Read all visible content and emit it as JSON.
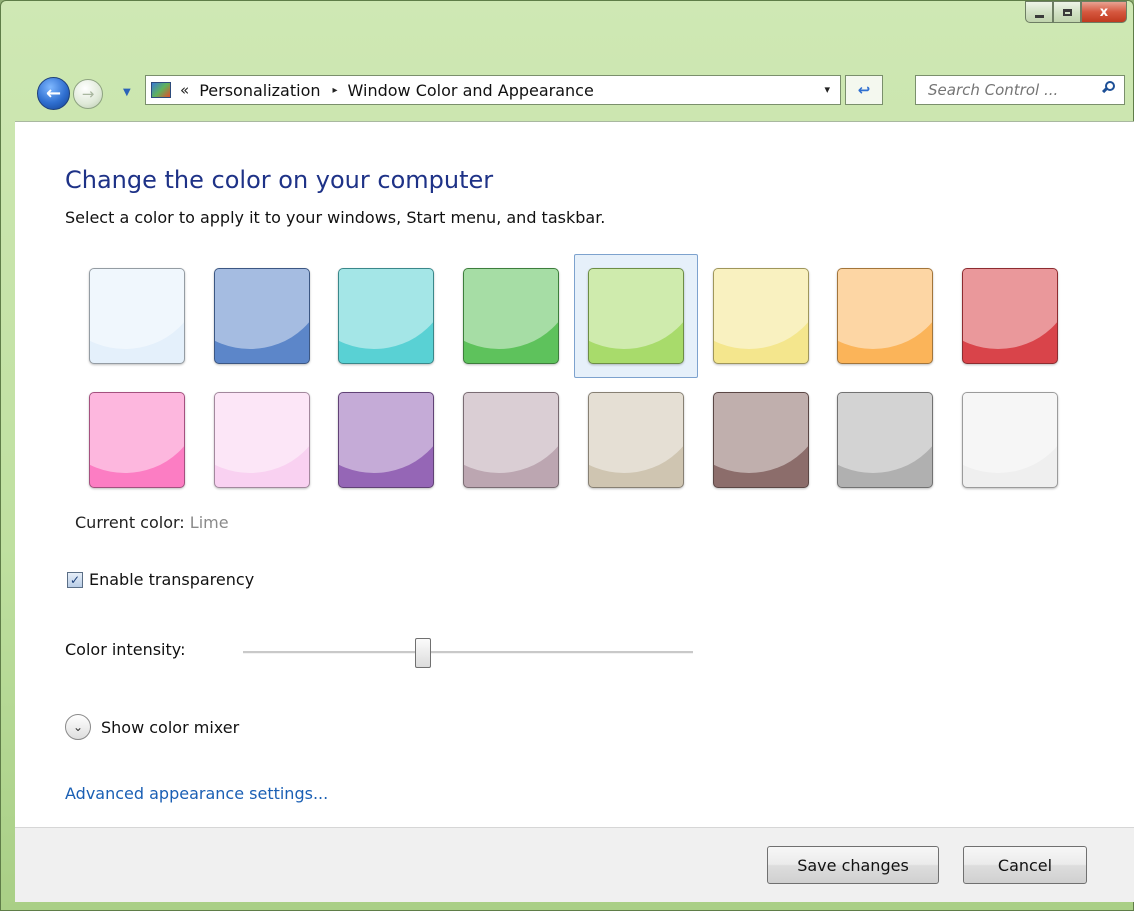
{
  "window": {
    "caption_buttons": {
      "minimize_icon": "minimize-icon",
      "maximize_icon": "maximize-icon",
      "close_label": "x"
    }
  },
  "nav": {
    "back_icon": "back-arrow-icon",
    "forward_icon": "forward-arrow-icon",
    "address": {
      "icon": "control-panel-icon",
      "chevron": "«",
      "segments": [
        "Personalization",
        "Window Color and Appearance"
      ],
      "separator": "▸",
      "dropdown": "▾"
    },
    "refresh_symbol": "↩",
    "search": {
      "placeholder": "Search Control ...",
      "value": ""
    }
  },
  "content": {
    "heading": "Change the color on your computer",
    "subtext": "Select a color to apply it to your windows, Start menu, and taskbar.",
    "swatches": [
      {
        "color": "#e4f0fb",
        "selected": false
      },
      {
        "color": "#5c86c9",
        "selected": false
      },
      {
        "color": "#59d1d4",
        "selected": false
      },
      {
        "color": "#5ec25c",
        "selected": false
      },
      {
        "color": "#a8db6b",
        "selected": true
      },
      {
        "color": "#f4e68d",
        "selected": false
      },
      {
        "color": "#fbb459",
        "selected": false
      },
      {
        "color": "#d9444a",
        "selected": false
      },
      {
        "color": "#fc7dc3",
        "selected": false
      },
      {
        "color": "#f9d1f1",
        "selected": false
      },
      {
        "color": "#9566b6",
        "selected": false
      },
      {
        "color": "#bca6b1",
        "selected": false
      },
      {
        "color": "#cfc5b1",
        "selected": false
      },
      {
        "color": "#8c6d6b",
        "selected": false
      },
      {
        "color": "#b0b0b0",
        "selected": false
      },
      {
        "color": "#efefef",
        "selected": false
      }
    ],
    "current_color_label": "Current color:",
    "current_color_value": "Lime",
    "transparency_label": "Enable transparency",
    "transparency_checked": true,
    "intensity_label": "Color intensity:",
    "intensity_fraction": 0.4,
    "mixer_label": "Show color mixer",
    "advanced_link": "Advanced appearance settings..."
  },
  "footer": {
    "save_label": "Save changes",
    "cancel_label": "Cancel"
  }
}
